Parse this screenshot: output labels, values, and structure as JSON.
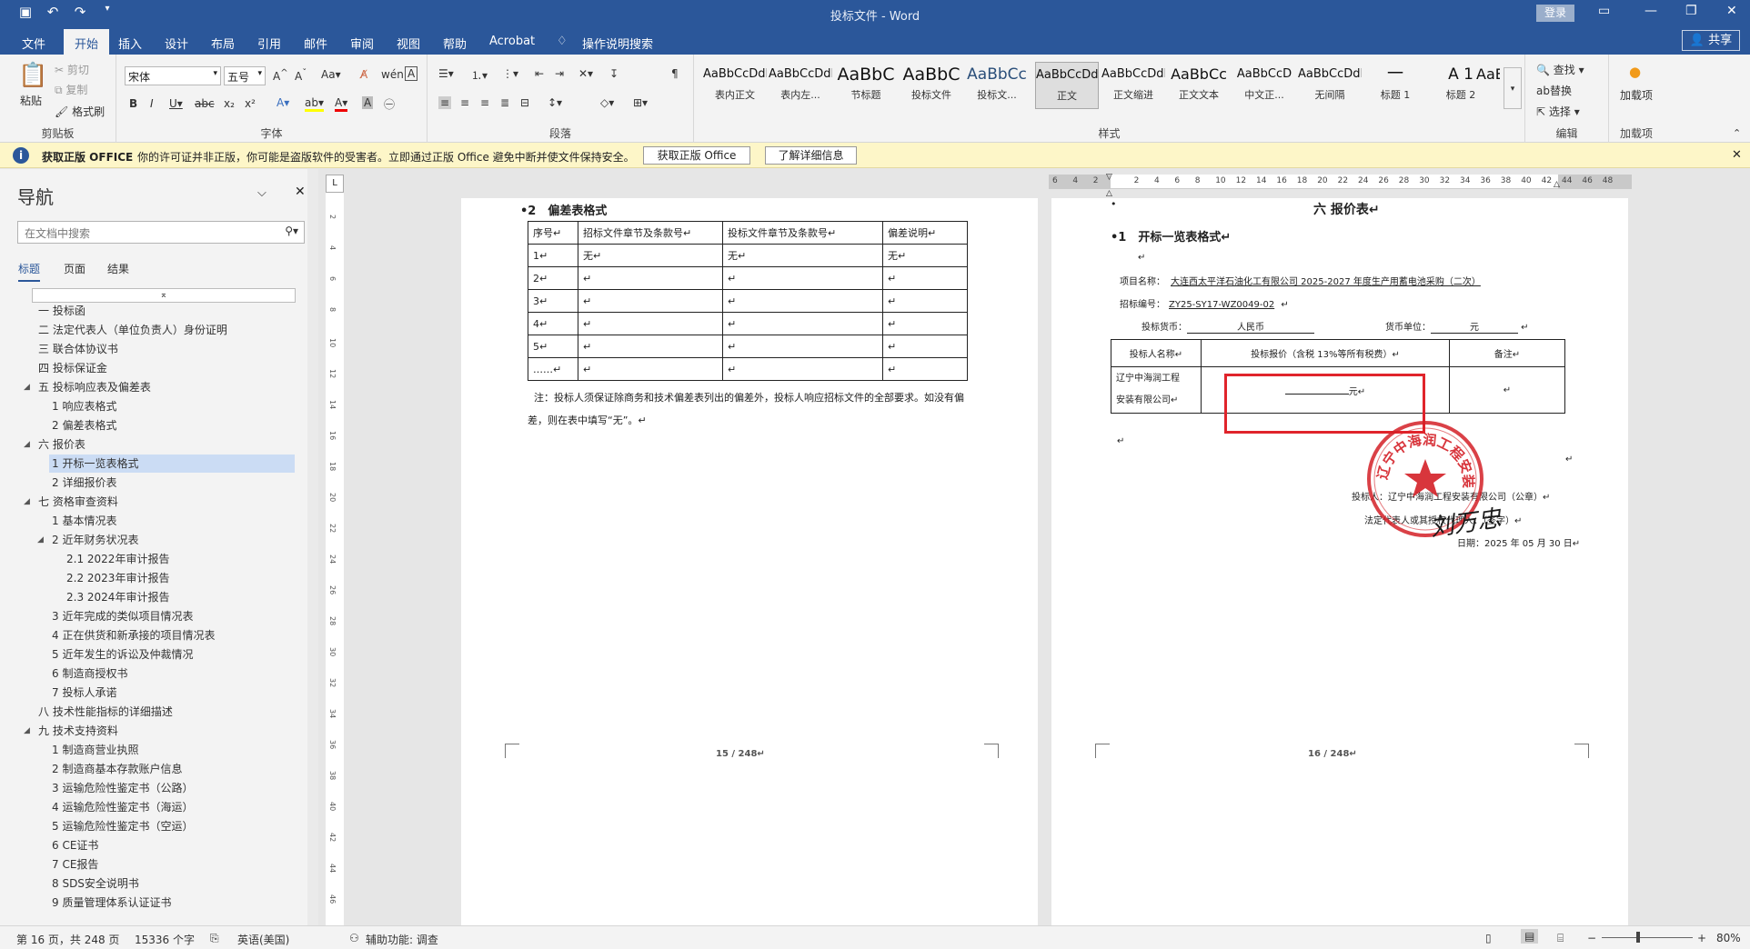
{
  "window": {
    "title": "投标文件 - Word",
    "login": "登录"
  },
  "tabs": [
    "文件",
    "开始",
    "插入",
    "设计",
    "布局",
    "引用",
    "邮件",
    "审阅",
    "视图",
    "帮助",
    "Acrobat",
    "操作说明搜索"
  ],
  "share": "共享",
  "ribbon": {
    "clipboard": {
      "label": "剪贴板",
      "paste": "粘贴",
      "cut": "剪切",
      "copy": "复制",
      "format_painter": "格式刷"
    },
    "font": {
      "label": "字体",
      "name": "宋体",
      "size": "五号"
    },
    "paragraph": {
      "label": "段落"
    },
    "styles": {
      "label": "样式",
      "items": [
        {
          "preview": "AaBbCcDdI",
          "name": "表内正文"
        },
        {
          "preview": "AaBbCcDdEe",
          "name": "表内左..."
        },
        {
          "preview": "AaBbC",
          "name": "节标题"
        },
        {
          "preview": "AaBbC",
          "name": "投标文件"
        },
        {
          "preview": "AaBbCc",
          "name": "投标文..."
        },
        {
          "preview": "AaBbCcDdI",
          "name": "正文"
        },
        {
          "preview": "AaBbCcDdI",
          "name": "正文缩进"
        },
        {
          "preview": "AaBbCc",
          "name": "正文文本"
        },
        {
          "preview": "AaBbCcD",
          "name": "中文正..."
        },
        {
          "preview": "AaBbCcDdI",
          "name": "无间隔"
        },
        {
          "preview": "一",
          "name": "标题 1"
        },
        {
          "preview": "A 1",
          "name": "标题 2"
        },
        {
          "preview": "AaE",
          "name": ""
        }
      ]
    },
    "editing": {
      "label": "编辑",
      "find": "查找",
      "replace": "替换",
      "select": "选择"
    },
    "addins": {
      "label": "加载项",
      "button": "加载项"
    }
  },
  "infobar": {
    "title": "获取正版 OFFICE",
    "message": "你的许可证并非正版，你可能是盗版软件的受害者。立即通过正版 Office 避免中断并使文件保持安全。",
    "btn1": "获取正版 Office",
    "btn2": "了解详细信息"
  },
  "nav": {
    "title": "导航",
    "search_placeholder": "在文档中搜索",
    "tabs": [
      "标题",
      "页面",
      "结果"
    ],
    "items": [
      {
        "text": "一 投标函",
        "level": 1
      },
      {
        "text": "二 法定代表人（单位负责人）身份证明",
        "level": 1
      },
      {
        "text": "三 联合体协议书",
        "level": 1
      },
      {
        "text": "四 投标保证金",
        "level": 1
      },
      {
        "text": "五 投标响应表及偏差表",
        "level": 1,
        "exp": true
      },
      {
        "text": "1 响应表格式",
        "level": 2
      },
      {
        "text": "2 偏差表格式",
        "level": 2
      },
      {
        "text": "六 报价表",
        "level": 1,
        "exp": true
      },
      {
        "text": "1 开标一览表格式",
        "level": 2,
        "selected": true
      },
      {
        "text": "2 详细报价表",
        "level": 2
      },
      {
        "text": "七 资格审查资料",
        "level": 1,
        "exp": true
      },
      {
        "text": "1 基本情况表",
        "level": 2
      },
      {
        "text": "2 近年财务状况表",
        "level": 2,
        "exp": true
      },
      {
        "text": "2.1 2022年审计报告",
        "level": 3
      },
      {
        "text": "2.2 2023年审计报告",
        "level": 3
      },
      {
        "text": "2.3 2024年审计报告",
        "level": 3
      },
      {
        "text": "3 近年完成的类似项目情况表",
        "level": 2
      },
      {
        "text": "4 正在供货和新承接的项目情况表",
        "level": 2
      },
      {
        "text": "5 近年发生的诉讼及仲裁情况",
        "level": 2
      },
      {
        "text": "6 制造商授权书",
        "level": 2
      },
      {
        "text": "7 投标人承诺",
        "level": 2
      },
      {
        "text": "八 技术性能指标的详细描述",
        "level": 1
      },
      {
        "text": "九 技术支持资料",
        "level": 1,
        "exp": true
      },
      {
        "text": "1 制造商营业执照",
        "level": 2
      },
      {
        "text": "2 制造商基本存款账户信息",
        "level": 2
      },
      {
        "text": "3 运输危险性鉴定书（公路）",
        "level": 2
      },
      {
        "text": "4 运输危险性鉴定书（海运）",
        "level": 2
      },
      {
        "text": "5 运输危险性鉴定书（空运）",
        "level": 2
      },
      {
        "text": "6 CE证书",
        "level": 2
      },
      {
        "text": "7 CE报告",
        "level": 2
      },
      {
        "text": "8 SDS安全说明书",
        "level": 2
      },
      {
        "text": "9 质量管理体系认证证书",
        "level": 2
      }
    ]
  },
  "ruler_numbers": [
    "6",
    "4",
    "2",
    "",
    "2",
    "4",
    "6",
    "8",
    "10",
    "12",
    "14",
    "16",
    "18",
    "20",
    "22",
    "24",
    "26",
    "28",
    "30",
    "32",
    "34",
    "36",
    "38",
    "40",
    "42",
    "44",
    "46",
    "48"
  ],
  "vruler_numbers": [
    "2",
    "4",
    "6",
    "8",
    "10",
    "12",
    "14",
    "16",
    "18",
    "20",
    "22",
    "24",
    "26",
    "28",
    "30",
    "32",
    "34",
    "36",
    "38",
    "40",
    "42",
    "44",
    "46",
    "48"
  ],
  "page15": {
    "heading": "•2　偏差表格式",
    "headers": [
      "序号↵",
      "招标文件章节及条款号↵",
      "投标文件章节及条款号↵",
      "偏差说明↵"
    ],
    "rows": [
      [
        "1↵",
        "无↵",
        "无↵",
        "无↵"
      ],
      [
        "2↵",
        "↵",
        "↵",
        "↵"
      ],
      [
        "3↵",
        "↵",
        "↵",
        "↵"
      ],
      [
        "4↵",
        "↵",
        "↵",
        "↵"
      ],
      [
        "5↵",
        "↵",
        "↵",
        "↵"
      ],
      [
        "……↵",
        "↵",
        "↵",
        "↵"
      ]
    ],
    "note1": "注：投标人须保证除商务和技术偏差表列出的偏差外，投标人响应招标文件的全部要求。如没有偏",
    "note2": "差，则在表中填写“无”。↵",
    "pageno": "15 / 248↵"
  },
  "page16": {
    "title": "六 报价表↵",
    "sub": "•1　开标一览表格式↵",
    "project_label": "项目名称：",
    "project": "大连西太平洋石油化工有限公司 2025-2027 年度生产用蓄电池采购（二次）",
    "bidno_label": "招标编号：",
    "bidno": "ZY25-SY17-WZ0049-02",
    "currency_label": "投标货币：",
    "currency": "人民币",
    "unit_label": "货币单位：",
    "unit": "元",
    "headers": [
      "投标人名称↵",
      "投标报价（含税 13%等所有税费）↵",
      "备注↵"
    ],
    "bidder1": "辽宁中海润工程",
    "bidder2": "安装有限公司↵",
    "price": "元↵",
    "remark": "↵",
    "sign1": "投标人：辽宁中海润工程安装有限公司（公章）↵",
    "sign2": "法定代表人或其授权代理人：（签字）↵",
    "date": "日期：2025 年 05 月 30 日↵",
    "pageno": "16 / 248↵",
    "seal_text": "辽宁中海润工程安装有限公司",
    "signature": "刘万忠"
  },
  "status": {
    "page": "第 16 页，共 248 页",
    "words": "15336 个字",
    "lang": "英语(美国)",
    "access": "辅助功能: 调查",
    "zoom": "80%"
  },
  "colors": {
    "brand": "#2b579a",
    "infobar": "#fdf6c8",
    "seal": "#d42027",
    "highlight_box": "#e0242b"
  }
}
